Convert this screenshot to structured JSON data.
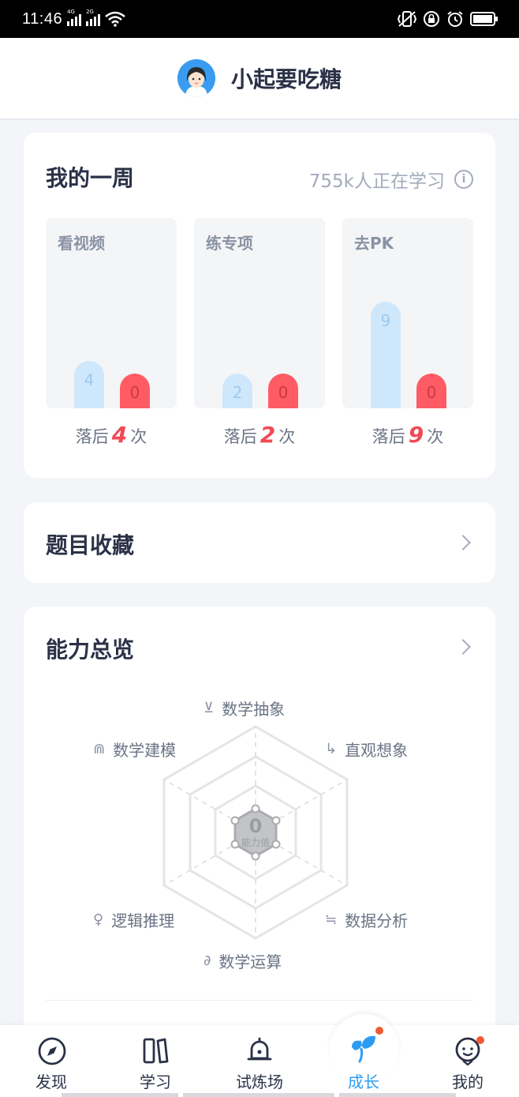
{
  "status_bar": {
    "time": "11:46",
    "net1": "4G",
    "net2": "2G"
  },
  "header": {
    "username": "小起要吃糖"
  },
  "week": {
    "title": "我的一周",
    "learners": "755k人正在学习",
    "info_glyph": "i",
    "stats": [
      {
        "label": "看视频",
        "mine": 4,
        "peer": 0,
        "behind_prefix": "落后",
        "behind_count": "4",
        "behind_suffix": "次"
      },
      {
        "label": "练专项",
        "mine": 2,
        "peer": 0,
        "behind_prefix": "落后",
        "behind_count": "2",
        "behind_suffix": "次"
      },
      {
        "label": "去PK",
        "mine": 9,
        "peer": 0,
        "behind_prefix": "落后",
        "behind_count": "9",
        "behind_suffix": "次"
      }
    ]
  },
  "favorites": {
    "title": "题目收藏"
  },
  "ability": {
    "title": "能力总览",
    "value": "0",
    "value_label": "能力值",
    "dimensions": [
      {
        "label": "数学抽象",
        "icon": "abstract-icon"
      },
      {
        "label": "直观想象",
        "icon": "imagination-icon"
      },
      {
        "label": "数据分析",
        "icon": "data-analysis-icon"
      },
      {
        "label": "数学运算",
        "icon": "calculation-icon"
      },
      {
        "label": "逻辑推理",
        "icon": "logic-icon"
      },
      {
        "label": "数学建模",
        "icon": "modeling-icon"
      }
    ],
    "levels": [
      0.04,
      0.04,
      0.04,
      0.04,
      0.04,
      0.04
    ]
  },
  "tabs": [
    {
      "label": "发现",
      "icon": "compass-icon"
    },
    {
      "label": "学习",
      "icon": "books-icon"
    },
    {
      "label": "试炼场",
      "icon": "bell-icon"
    },
    {
      "label": "成长",
      "icon": "sprout-icon",
      "active": true,
      "badge": true
    },
    {
      "label": "我的",
      "icon": "face-icon",
      "badge": true
    }
  ],
  "colors": {
    "accent": "#2d9cf0",
    "behind": "#f04a55",
    "peer_bar": "#ff5b64",
    "mine_bar": "#cfe7fb"
  }
}
